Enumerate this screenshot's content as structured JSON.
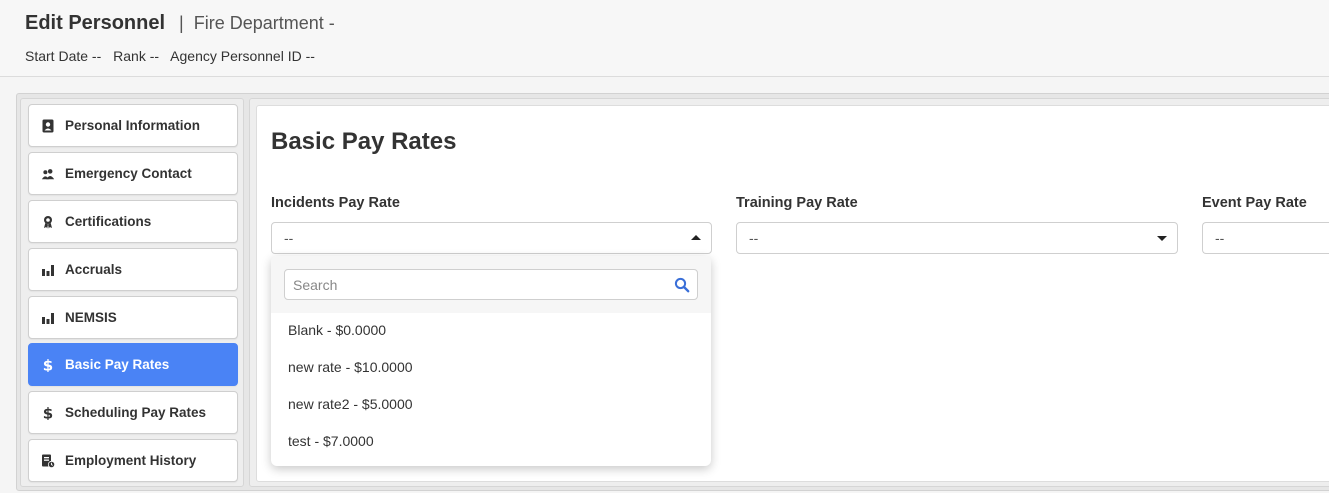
{
  "header": {
    "title": "Edit Personnel",
    "separator": "|",
    "subtitle": "Fire Department -",
    "meta": {
      "start_date": "Start Date --",
      "rank": "Rank --",
      "agency_id": "Agency Personnel ID --"
    }
  },
  "sidebar": {
    "items": [
      {
        "label": "Personal Information",
        "icon": "contact-card-icon"
      },
      {
        "label": "Emergency Contact",
        "icon": "users-icon"
      },
      {
        "label": "Certifications",
        "icon": "award-icon"
      },
      {
        "label": "Accruals",
        "icon": "bar-chart-icon"
      },
      {
        "label": "NEMSIS",
        "icon": "bar-chart-icon"
      },
      {
        "label": "Basic Pay Rates",
        "icon": "dollar-icon",
        "active": true
      },
      {
        "label": "Scheduling Pay Rates",
        "icon": "dollar-icon"
      },
      {
        "label": "Employment History",
        "icon": "history-document-icon"
      }
    ]
  },
  "main": {
    "title": "Basic Pay Rates",
    "fields": [
      {
        "label": "Incidents Pay Rate",
        "value": "--"
      },
      {
        "label": "Training Pay Rate",
        "value": "--"
      },
      {
        "label": "Event Pay Rate",
        "value": "--"
      }
    ],
    "dropdown": {
      "search_placeholder": "Search",
      "options": [
        "Blank - $0.0000",
        "new rate - $10.0000",
        "new rate2 - $5.0000",
        "test - $7.0000"
      ]
    }
  },
  "colors": {
    "accent": "#4a83f5",
    "search_icon": "#3a6fd8"
  }
}
